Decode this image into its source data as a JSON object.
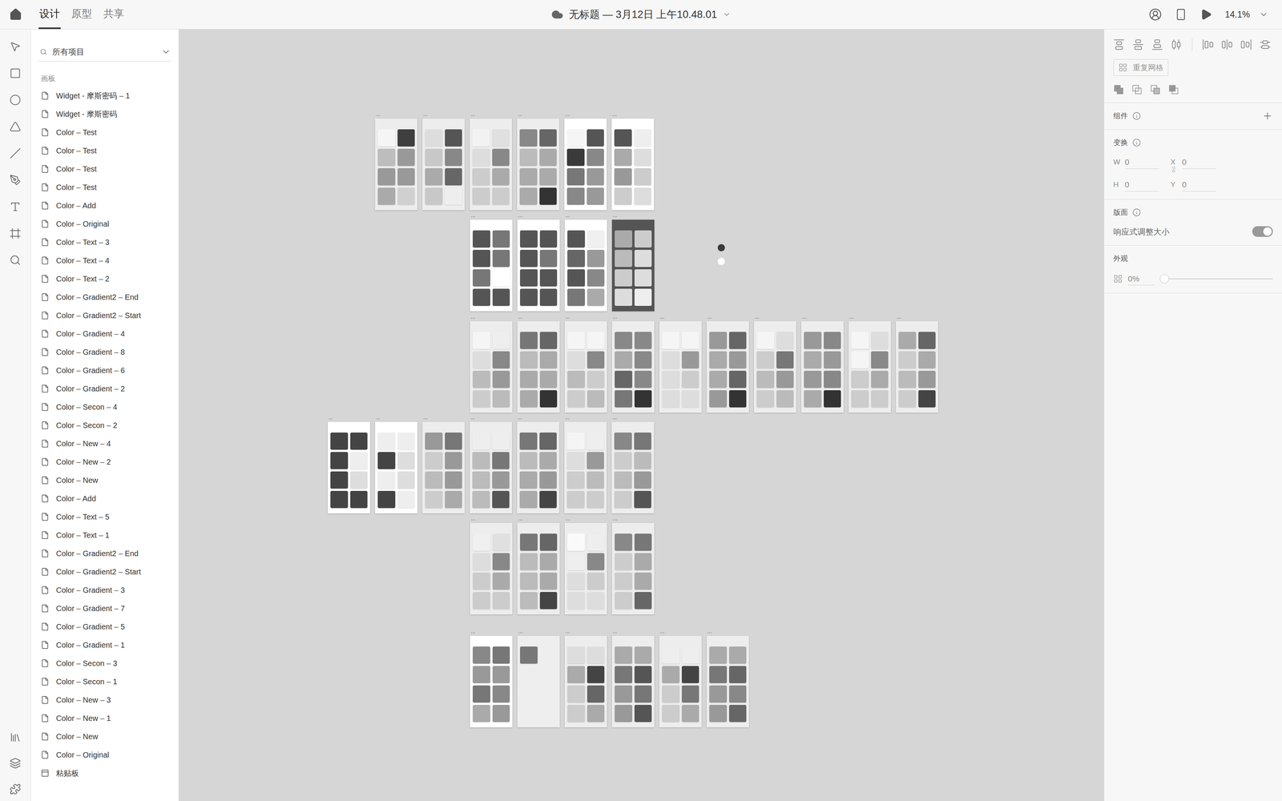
{
  "topbar": {
    "tabs": [
      {
        "label": "设计",
        "selected": true
      },
      {
        "label": "原型",
        "selected": false
      },
      {
        "label": "共享",
        "selected": false
      }
    ],
    "title": "无标题 — 3月12日 上午10.48.01",
    "zoom": "14.1%"
  },
  "layers": {
    "search": "所有项目",
    "section": "画板",
    "items": [
      {
        "label": "Widget - 摩斯密码 – 1",
        "kind": "artboard"
      },
      {
        "label": "Widget - 摩斯密码",
        "kind": "artboard"
      },
      {
        "label": "Color – Test",
        "kind": "artboard"
      },
      {
        "label": "Color – Test",
        "kind": "artboard"
      },
      {
        "label": "Color – Test",
        "kind": "artboard"
      },
      {
        "label": "Color – Test",
        "kind": "artboard"
      },
      {
        "label": "Color – Add",
        "kind": "artboard"
      },
      {
        "label": "Color – Original",
        "kind": "artboard"
      },
      {
        "label": "Color – Text – 3",
        "kind": "artboard"
      },
      {
        "label": "Color – Text – 4",
        "kind": "artboard"
      },
      {
        "label": "Color – Text – 2",
        "kind": "artboard"
      },
      {
        "label": "Color – Gradient2 – End",
        "kind": "artboard"
      },
      {
        "label": "Color – Gradient2 – Start",
        "kind": "artboard"
      },
      {
        "label": "Color – Gradient – 4",
        "kind": "artboard"
      },
      {
        "label": "Color – Gradient – 8",
        "kind": "artboard"
      },
      {
        "label": "Color – Gradient – 6",
        "kind": "artboard"
      },
      {
        "label": "Color – Gradient – 2",
        "kind": "artboard"
      },
      {
        "label": "Color – Secon – 4",
        "kind": "artboard"
      },
      {
        "label": "Color – Secon – 2",
        "kind": "artboard"
      },
      {
        "label": "Color – New – 4",
        "kind": "artboard"
      },
      {
        "label": "Color – New – 2",
        "kind": "artboard"
      },
      {
        "label": "Color – New",
        "kind": "artboard"
      },
      {
        "label": "Color – Add",
        "kind": "artboard"
      },
      {
        "label": "Color – Text – 5",
        "kind": "artboard"
      },
      {
        "label": "Color – Text – 1",
        "kind": "artboard"
      },
      {
        "label": "Color – Gradient2 – End",
        "kind": "artboard"
      },
      {
        "label": "Color – Gradient2 – Start",
        "kind": "artboard"
      },
      {
        "label": "Color – Gradient – 3",
        "kind": "artboard"
      },
      {
        "label": "Color – Gradient – 7",
        "kind": "artboard"
      },
      {
        "label": "Color – Gradient – 5",
        "kind": "artboard"
      },
      {
        "label": "Color – Gradient – 1",
        "kind": "artboard"
      },
      {
        "label": "Color – Secon – 3",
        "kind": "artboard"
      },
      {
        "label": "Color – Secon – 1",
        "kind": "artboard"
      },
      {
        "label": "Color – New – 3",
        "kind": "artboard"
      },
      {
        "label": "Color – New – 1",
        "kind": "artboard"
      },
      {
        "label": "Color – New",
        "kind": "artboard"
      },
      {
        "label": "Color – Original",
        "kind": "artboard"
      },
      {
        "label": "粘贴板",
        "kind": "pasteboard"
      }
    ]
  },
  "canvas": {
    "rows": [
      [
        {
          "label": "...",
          "bg": "#ededed",
          "tiles": [
            "#f5f5f5",
            "#3f3f3f",
            "#bdbdbd",
            "#999999",
            "#999999",
            "#999999",
            "#aaaaaa",
            "#d0d0d0"
          ]
        },
        {
          "label": "...",
          "bg": "#ededed",
          "tiles": [
            "#dddddd",
            "#555555",
            "#c8c8c8",
            "#888888",
            "#aaaaaa",
            "#666666",
            "#c8c8c8",
            "#eeeeee"
          ]
        },
        {
          "label": "...",
          "bg": "#ededed",
          "tiles": [
            "#f2f2f2",
            "#e0e0e0",
            "#dddddd",
            "#888888",
            "#cccccc",
            "#aaaaaa",
            "#cccccc",
            "#cccccc"
          ]
        },
        {
          "label": "...",
          "bg": "#ededed",
          "tiles": [
            "#888888",
            "#666666",
            "#bbbbbb",
            "#aaaaaa",
            "#aaaaaa",
            "#aaaaaa",
            "#aaaaaa",
            "#333333"
          ]
        },
        {
          "label": "...",
          "bg": "#ffffff",
          "tiles": [
            "#f5f5f5",
            "#555555",
            "#3a3a3a",
            "#888888",
            "#777777",
            "#999999",
            "#888888",
            "#999999"
          ]
        },
        {
          "label": "...",
          "bg": "#ffffff",
          "tiles": [
            "#555555",
            "#eeeeee",
            "#aaaaaa",
            "#dddddd",
            "#999999",
            "#cccccc",
            "#cccccc",
            "#dddddd"
          ]
        }
      ],
      [
        {
          "label": "...",
          "bg": "#ffffff",
          "tiles": [
            "#555555",
            "#777777",
            "#555555",
            "#777777",
            "#777777",
            "#ffffff",
            "#555555",
            "#555555"
          ]
        },
        {
          "label": "...",
          "bg": "#ffffff",
          "tiles": [
            "#555555",
            "#555555",
            "#555555",
            "#777777",
            "#555555",
            "#555555",
            "#555555",
            "#555555"
          ]
        },
        {
          "label": "...",
          "bg": "#ffffff",
          "tiles": [
            "#555555",
            "#f0f0f0",
            "#666666",
            "#999999",
            "#555555",
            "#888888",
            "#777777",
            "#aaaaaa"
          ]
        },
        {
          "label": "...",
          "bg": "#555555",
          "tiles": [
            "#aaaaaa",
            "#cccccc",
            "#bbbbbb",
            "#dddddd",
            "#cccccc",
            "#dddddd",
            "#dddddd",
            "#eeeeee"
          ]
        }
      ],
      [
        {
          "label": "...",
          "bg": "#ededed",
          "tiles": [
            "#f5f5f5",
            "#eeeeee",
            "#dddddd",
            "#888888",
            "#bbbbbb",
            "#999999",
            "#cccccc",
            "#bbbbbb"
          ]
        },
        {
          "label": "...",
          "bg": "#ededed",
          "tiles": [
            "#777777",
            "#666666",
            "#bbbbbb",
            "#aaaaaa",
            "#aaaaaa",
            "#aaaaaa",
            "#aaaaaa",
            "#333333"
          ]
        },
        {
          "label": "...",
          "bg": "#ededed",
          "tiles": [
            "#f5f5f5",
            "#f5f5f5",
            "#dddddd",
            "#888888",
            "#bbbbbb",
            "#cccccc",
            "#cccccc",
            "#bbbbbb"
          ]
        },
        {
          "label": "...",
          "bg": "#ededed",
          "tiles": [
            "#888888",
            "#888888",
            "#aaaaaa",
            "#888888",
            "#666666",
            "#888888",
            "#777777",
            "#333333"
          ]
        },
        {
          "label": "...",
          "bg": "#ededed",
          "tiles": [
            "#f5f5f5",
            "#f5f5f5",
            "#dddddd",
            "#999999",
            "#dddddd",
            "#cccccc",
            "#dddddd",
            "#dddddd"
          ]
        },
        {
          "label": "...",
          "bg": "#ededed",
          "tiles": [
            "#999999",
            "#666666",
            "#aaaaaa",
            "#999999",
            "#aaaaaa",
            "#666666",
            "#999999",
            "#333333"
          ]
        },
        {
          "label": "...",
          "bg": "#ededed",
          "tiles": [
            "#f5f5f5",
            "#dddddd",
            "#cccccc",
            "#777777",
            "#bbbbbb",
            "#999999",
            "#cccccc",
            "#bbbbbb"
          ]
        },
        {
          "label": "...",
          "bg": "#ededed",
          "tiles": [
            "#999999",
            "#888888",
            "#aaaaaa",
            "#999999",
            "#999999",
            "#888888",
            "#aaaaaa",
            "#333333"
          ]
        },
        {
          "label": "...",
          "bg": "#ededed",
          "tiles": [
            "#f5f5f5",
            "#dddddd",
            "#f5f5f5",
            "#888888",
            "#cccccc",
            "#aaaaaa",
            "#cccccc",
            "#cccccc"
          ]
        },
        {
          "label": "...",
          "bg": "#ededed",
          "tiles": [
            "#aaaaaa",
            "#666666",
            "#cccccc",
            "#aaaaaa",
            "#bbbbbb",
            "#999999",
            "#cccccc",
            "#444444"
          ]
        }
      ],
      [
        {
          "label": "...",
          "bg": "#ffffff",
          "tiles": [
            "#444444",
            "#444444",
            "#444444",
            "#eeeeee",
            "#444444",
            "#dddddd",
            "#444444",
            "#444444"
          ]
        },
        {
          "label": "...",
          "bg": "#ffffff",
          "tiles": [
            "#eeeeee",
            "#eeeeee",
            "#444444",
            "#dddddd",
            "#eeeeee",
            "#dddddd",
            "#444444",
            "#eeeeee"
          ]
        },
        {
          "label": "...",
          "bg": "#ededed",
          "tiles": [
            "#999999",
            "#777777",
            "#cccccc",
            "#999999",
            "#bbbbbb",
            "#999999",
            "#cccccc",
            "#aaaaaa"
          ]
        },
        {
          "label": "...",
          "bg": "#ededed",
          "tiles": [
            "#eeeeee",
            "#eeeeee",
            "#bbbbbb",
            "#777777",
            "#bbbbbb",
            "#999999",
            "#bbbbbb",
            "#555555"
          ]
        },
        {
          "label": "...",
          "bg": "#ededed",
          "tiles": [
            "#777777",
            "#666666",
            "#bbbbbb",
            "#aaaaaa",
            "#aaaaaa",
            "#999999",
            "#aaaaaa",
            "#444444"
          ]
        },
        {
          "label": "...",
          "bg": "#ededed",
          "tiles": [
            "#f5f5f5",
            "#eeeeee",
            "#dddddd",
            "#999999",
            "#cccccc",
            "#bbbbbb",
            "#cccccc",
            "#cccccc"
          ]
        },
        {
          "label": "...",
          "bg": "#ededed",
          "tiles": [
            "#888888",
            "#777777",
            "#cccccc",
            "#bbbbbb",
            "#bbbbbb",
            "#999999",
            "#cccccc",
            "#555555"
          ]
        }
      ],
      [
        {
          "label": "...",
          "bg": "#ededed",
          "tiles": [
            "#f0f0f0",
            "#e0e0e0",
            "#dddddd",
            "#888888",
            "#cccccc",
            "#aaaaaa",
            "#cccccc",
            "#cccccc"
          ]
        },
        {
          "label": "...",
          "bg": "#ededed",
          "tiles": [
            "#777777",
            "#666666",
            "#bbbbbb",
            "#aaaaaa",
            "#bbbbbb",
            "#aaaaaa",
            "#bbbbbb",
            "#444444"
          ]
        },
        {
          "label": "...",
          "bg": "#ededed",
          "tiles": [
            "#fafafa",
            "#eeeeee",
            "#eeeeee",
            "#888888",
            "#dddddd",
            "#cccccc",
            "#dddddd",
            "#dddddd"
          ]
        },
        {
          "label": "...",
          "bg": "#ededed",
          "tiles": [
            "#888888",
            "#777777",
            "#cccccc",
            "#aaaaaa",
            "#cccccc",
            "#aaaaaa",
            "#cccccc",
            "#666666"
          ]
        }
      ],
      [
        {
          "label": "...",
          "bg": "#ffffff",
          "tiles": [
            "#888888",
            "#777777",
            "#999999",
            "#999999",
            "#777777",
            "#888888",
            "#aaaaaa",
            "#999999"
          ]
        },
        {
          "label": "...",
          "bg": "#eeeeee",
          "tiles": [
            "#777777"
          ]
        },
        {
          "label": "...",
          "bg": "#ededed",
          "tiles": [
            "#dddddd",
            "#dddddd",
            "#aaaaaa",
            "#444444",
            "#cccccc",
            "#666666",
            "#cccccc",
            "#aaaaaa"
          ]
        },
        {
          "label": "...",
          "bg": "#ededed",
          "tiles": [
            "#aaaaaa",
            "#aaaaaa",
            "#777777",
            "#555555",
            "#999999",
            "#777777",
            "#999999",
            "#555555"
          ]
        },
        {
          "label": "...",
          "bg": "#ededed",
          "tiles": [
            "#eeeeee",
            "#eeeeee",
            "#aaaaaa",
            "#444444",
            "#cccccc",
            "#777777",
            "#cccccc",
            "#aaaaaa"
          ]
        },
        {
          "label": "...",
          "bg": "#ededed",
          "tiles": [
            "#aaaaaa",
            "#aaaaaa",
            "#777777",
            "#666666",
            "#999999",
            "#888888",
            "#999999",
            "#666666"
          ]
        }
      ]
    ],
    "dots": [
      {
        "color": "#3a3a3a"
      },
      {
        "color": "#ffffff"
      }
    ]
  },
  "inspector": {
    "repeatGrid": "重复网格",
    "component": "组件",
    "transform": {
      "title": "变换",
      "fields": [
        {
          "label": "W",
          "value": "0"
        },
        {
          "label": "X",
          "value": "0"
        },
        {
          "label": "H",
          "value": "0"
        },
        {
          "label": "Y",
          "value": "0"
        }
      ]
    },
    "layout": {
      "title": "版面",
      "responsive": {
        "label": "响应式调整大小",
        "on": true
      }
    },
    "appearance": {
      "title": "外观",
      "opacity": {
        "reading": "0%",
        "level": 0
      }
    }
  }
}
